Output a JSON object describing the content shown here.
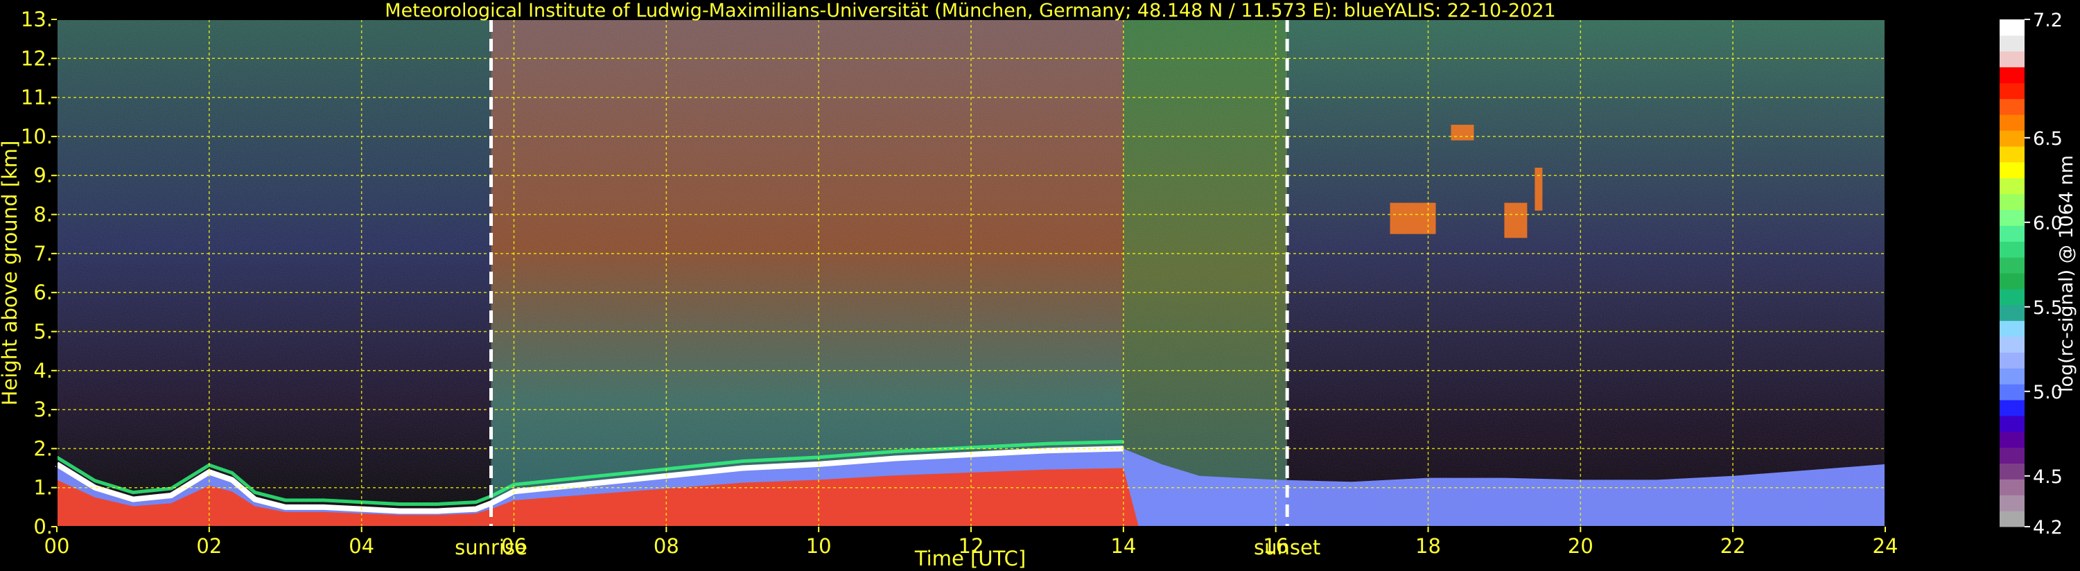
{
  "chart_data": {
    "type": "heatmap",
    "title": "Meteorological Institute of Ludwig-Maximilians-Universität (München, Germany; 48.148 N / 11.573 E):     blueYALIS: 22-10-2021",
    "xlabel": "Time [UTC]",
    "ylabel": "Height above ground [km]",
    "xlim": [
      0,
      24
    ],
    "ylim": [
      0,
      13
    ],
    "x_ticks": [
      0,
      2,
      4,
      6,
      8,
      10,
      12,
      14,
      16,
      18,
      20,
      22,
      24
    ],
    "x_tick_labels": [
      "00",
      "02",
      "04",
      "06",
      "08",
      "10",
      "12",
      "14",
      "16",
      "18",
      "20",
      "22",
      "24"
    ],
    "y_ticks": [
      0,
      1,
      2,
      3,
      4,
      5,
      6,
      7,
      8,
      9,
      10,
      11,
      12,
      13
    ],
    "y_tick_labels": [
      "0.",
      "1.",
      "2.",
      "3.",
      "4.",
      "5.",
      "6.",
      "7.",
      "8.",
      "9.",
      "10.",
      "11.",
      "12.",
      "13."
    ],
    "grid": true,
    "colorbar": {
      "label": "log(rc-signal) @ 1064 nm",
      "range": [
        4.2,
        7.2
      ],
      "ticks": [
        4.2,
        4.5,
        5.0,
        5.5,
        6.0,
        6.5,
        7.2
      ],
      "tick_labels": [
        "4.2",
        "4.5",
        "5.0",
        "5.5",
        "6.0",
        "6.5",
        "7.2"
      ],
      "colors": [
        "#a9a9a9",
        "#a990a8",
        "#9e6f99",
        "#7c3f86",
        "#6a1a8a",
        "#5a009e",
        "#3c00c8",
        "#2222ff",
        "#5a78ff",
        "#7b9bff",
        "#9ab0ff",
        "#aac8ff",
        "#8ad8ff",
        "#28a890",
        "#18b878",
        "#22b050",
        "#2ec060",
        "#36d87c",
        "#50ef96",
        "#7cff88",
        "#9cff60",
        "#c2ff40",
        "#ffff00",
        "#ffd800",
        "#ffa500",
        "#ff8000",
        "#ff5a10",
        "#ff2000",
        "#ff0000",
        "#f0c8c8",
        "#e8e8e8",
        "#ffffff"
      ]
    },
    "markers": [
      {
        "label": "sunrise",
        "x": 5.7
      },
      {
        "label": "sunset",
        "x": 16.15
      }
    ],
    "data_summary": {
      "boundary_layer_top_km": [
        [
          0.0,
          1.6
        ],
        [
          0.5,
          1.0
        ],
        [
          1.0,
          0.7
        ],
        [
          1.5,
          0.8
        ],
        [
          2.0,
          1.4
        ],
        [
          2.3,
          1.2
        ],
        [
          2.6,
          0.7
        ],
        [
          3.0,
          0.5
        ],
        [
          3.5,
          0.5
        ],
        [
          4.0,
          0.45
        ],
        [
          4.5,
          0.4
        ],
        [
          5.0,
          0.4
        ],
        [
          5.5,
          0.45
        ],
        [
          5.7,
          0.6
        ],
        [
          6.0,
          0.9
        ],
        [
          7.0,
          1.1
        ],
        [
          8.0,
          1.3
        ],
        [
          9.0,
          1.5
        ],
        [
          10.0,
          1.6
        ],
        [
          11.0,
          1.75
        ],
        [
          12.0,
          1.85
        ],
        [
          13.0,
          1.95
        ],
        [
          14.0,
          2.0
        ],
        [
          14.5,
          1.6
        ],
        [
          15.0,
          1.3
        ],
        [
          16.0,
          1.2
        ],
        [
          17.0,
          1.15
        ],
        [
          18.0,
          1.25
        ],
        [
          19.0,
          1.25
        ],
        [
          20.0,
          1.2
        ],
        [
          21.0,
          1.2
        ],
        [
          22.0,
          1.3
        ],
        [
          23.0,
          1.45
        ],
        [
          24.0,
          1.6
        ]
      ],
      "cirrus_cloud_patches": [
        {
          "x_start": 17.5,
          "x_end": 18.1,
          "y_bottom_km": 7.5,
          "y_top_km": 8.3
        },
        {
          "x_start": 18.3,
          "x_end": 18.6,
          "y_bottom_km": 9.9,
          "y_top_km": 10.3
        },
        {
          "x_start": 19.0,
          "x_end": 19.3,
          "y_bottom_km": 7.4,
          "y_top_km": 8.3
        },
        {
          "x_start": 19.4,
          "x_end": 19.5,
          "y_bottom_km": 8.1,
          "y_top_km": 9.2
        }
      ]
    }
  }
}
